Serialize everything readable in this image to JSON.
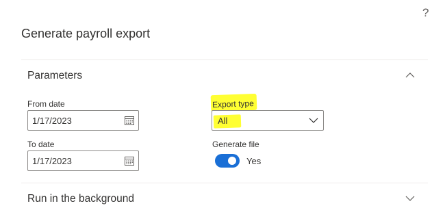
{
  "dialog": {
    "title": "Generate payroll export",
    "help_label": "?"
  },
  "sections": {
    "parameters": {
      "label": "Parameters",
      "expanded": true,
      "from_date": {
        "label": "From date",
        "value": "1/17/2023"
      },
      "to_date": {
        "label": "To date",
        "value": "1/17/2023"
      },
      "export_type": {
        "label": "Export type",
        "value": "All"
      },
      "generate_file": {
        "label": "Generate file",
        "checked": true,
        "state_text": "Yes"
      }
    },
    "run_background": {
      "label": "Run in the background",
      "expanded": false
    }
  },
  "colors": {
    "toggle_on": "#1a6fd6",
    "highlight": "#ffff33",
    "border": "#8a8886"
  },
  "icons": {
    "help": "question-mark",
    "collapse": "chevron-up-icon",
    "expand": "chevron-down-icon",
    "calendar": "calendar-icon",
    "dropdown": "chevron-down-icon"
  }
}
